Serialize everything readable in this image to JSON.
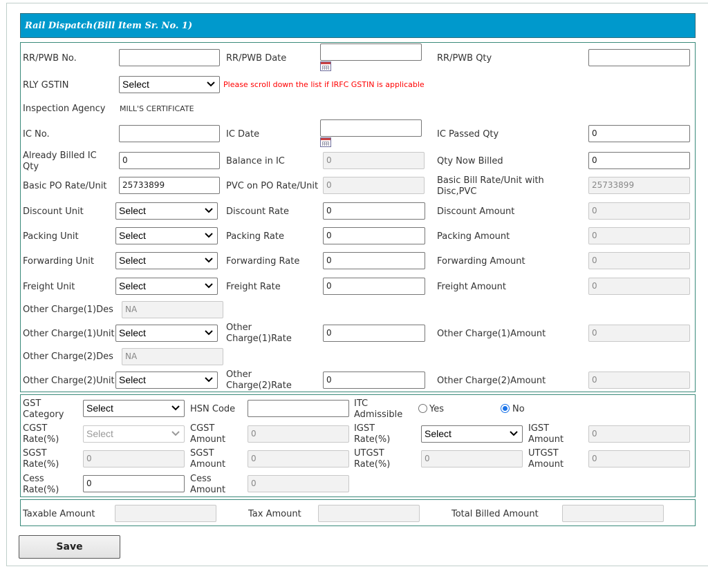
{
  "header": {
    "title": "Rail Dispatch(Bill Item Sr. No. 1)"
  },
  "dispatch": {
    "rr_no_label": "RR/PWB No.",
    "rr_no_value": "",
    "rr_date_label": "RR/PWB Date",
    "rr_date_value": "",
    "rr_qty_label": "RR/PWB Qty",
    "rr_qty_value": "",
    "rly_gstin_label": "RLY GSTIN",
    "rly_gstin_value": "Select",
    "rly_gstin_note": "Please scroll down the list if IRFC GSTIN is applicable",
    "inspection_label": "Inspection Agency",
    "inspection_value": "MILL'S CERTIFICATE",
    "ic_no_label": "IC No.",
    "ic_no_value": "",
    "ic_date_label": "IC Date",
    "ic_date_value": "",
    "ic_passed_label": "IC Passed Qty",
    "ic_passed_value": "0",
    "already_billed_label": "Already Billed IC Qty",
    "already_billed_value": "0",
    "balance_ic_label": "Balance in IC",
    "balance_ic_value": "0",
    "qty_now_label": "Qty Now Billed",
    "qty_now_value": "0",
    "basic_po_label": "Basic PO Rate/Unit",
    "basic_po_value": "25733899",
    "pvc_label": "PVC on PO Rate/Unit",
    "pvc_value": "0",
    "basic_bill_label": "Basic Bill Rate/Unit with Disc,PVC",
    "basic_bill_value": "25733899",
    "discount_unit_label": "Discount Unit",
    "discount_unit_value": "Select",
    "discount_rate_label": "Discount Rate",
    "discount_rate_value": "0",
    "discount_amount_label": "Discount Amount",
    "discount_amount_value": "0",
    "packing_unit_label": "Packing Unit",
    "packing_unit_value": "Select",
    "packing_rate_label": "Packing Rate",
    "packing_rate_value": "0",
    "packing_amount_label": "Packing Amount",
    "packing_amount_value": "0",
    "forwarding_unit_label": "Forwarding Unit",
    "forwarding_unit_value": "Select",
    "forwarding_rate_label": "Forwarding Rate",
    "forwarding_rate_value": "0",
    "forwarding_amount_label": "Forwarding Amount",
    "forwarding_amount_value": "0",
    "freight_unit_label": "Freight Unit",
    "freight_unit_value": "Select",
    "freight_rate_label": "Freight Rate",
    "freight_rate_value": "0",
    "freight_amount_label": "Freight Amount",
    "freight_amount_value": "0",
    "oc1_des_label": "Other Charge(1)Des",
    "oc1_des_value": "NA",
    "oc1_unit_label": "Other Charge(1)Unit",
    "oc1_unit_value": "Select",
    "oc1_rate_label": "Other Charge(1)Rate",
    "oc1_rate_value": "0",
    "oc1_amount_label": "Other Charge(1)Amount",
    "oc1_amount_value": "0",
    "oc2_des_label": "Other Charge(2)Des",
    "oc2_des_value": "NA",
    "oc2_unit_label": "Other Charge(2)Unit",
    "oc2_unit_value": "Select",
    "oc2_rate_label": "Other Charge(2)Rate",
    "oc2_rate_value": "0",
    "oc2_amount_label": "Other Charge(2)Amount",
    "oc2_amount_value": "0"
  },
  "gst": {
    "category_label": "GST Category",
    "category_value": "Select",
    "hsn_label": "HSN Code",
    "hsn_value": "",
    "itc_label": "ITC Admissible",
    "itc_yes": "Yes",
    "itc_no": "No",
    "itc_selected": "No",
    "cgst_rate_label": "CGST Rate(%)",
    "cgst_rate_value": "Select",
    "cgst_amount_label": "CGST Amount",
    "cgst_amount_value": "0",
    "igst_rate_label": "IGST Rate(%)",
    "igst_rate_value": "Select",
    "igst_amount_label": "IGST Amount",
    "igst_amount_value": "0",
    "sgst_rate_label": "SGST Rate(%)",
    "sgst_rate_value": "0",
    "sgst_amount_label": "SGST Amount",
    "sgst_amount_value": "0",
    "utgst_rate_label": "UTGST Rate(%)",
    "utgst_rate_value": "0",
    "utgst_amount_label": "UTGST Amount",
    "utgst_amount_value": "0",
    "cess_rate_label": "Cess Rate(%)",
    "cess_rate_value": "0",
    "cess_amount_label": "Cess Amount",
    "cess_amount_value": "0"
  },
  "totals": {
    "taxable_label": "Taxable Amount",
    "taxable_value": "",
    "tax_label": "Tax Amount",
    "tax_value": "",
    "total_label": "Total Billed Amount",
    "total_value": ""
  },
  "actions": {
    "save_label": "Save"
  },
  "colors": {
    "header_bg": "#0099cc",
    "border": "#3a8a7a",
    "warning": "#ff0000",
    "radio_selected": "#1a73e8"
  }
}
